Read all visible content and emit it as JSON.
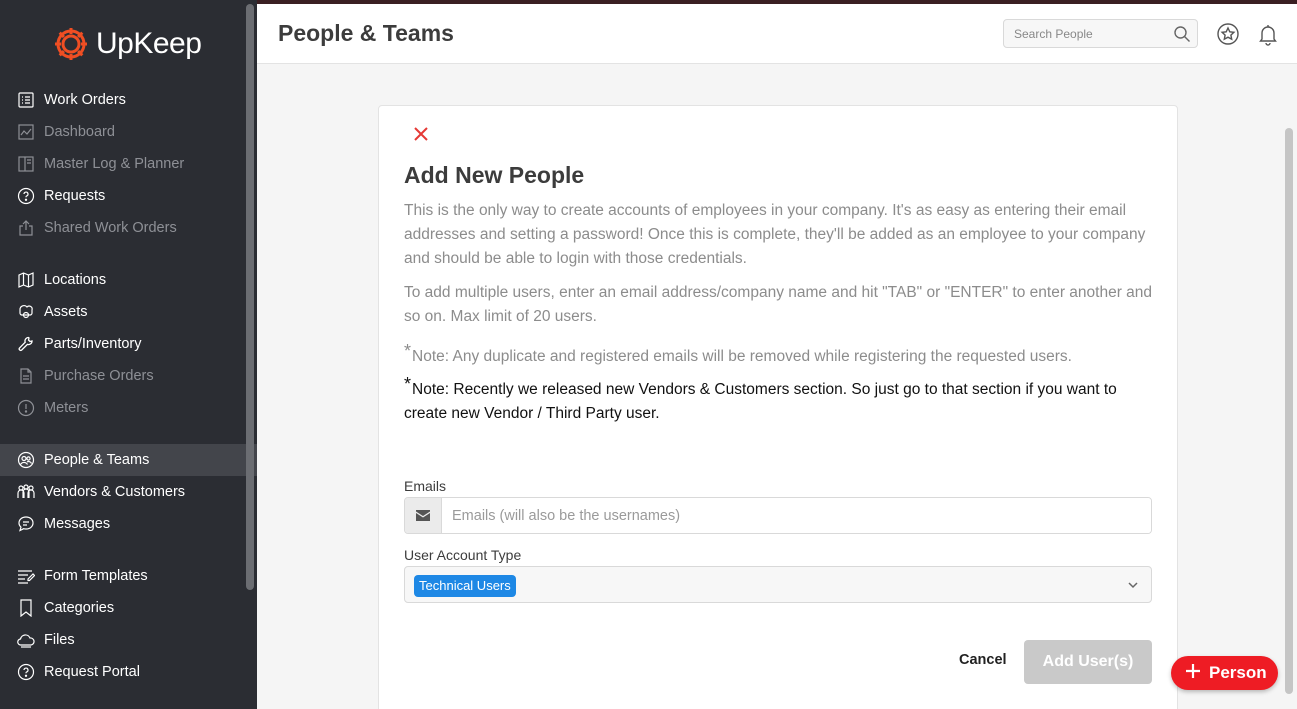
{
  "app": {
    "name": "UpKeep",
    "brand_color": "#f04e23"
  },
  "sidebar": {
    "groups": [
      [
        {
          "label": "Work Orders",
          "icon": "list-icon",
          "dim": false
        },
        {
          "label": "Dashboard",
          "icon": "chart-icon",
          "dim": true
        },
        {
          "label": "Master Log & Planner",
          "icon": "planner-icon",
          "dim": true
        },
        {
          "label": "Requests",
          "icon": "question-icon",
          "dim": false
        },
        {
          "label": "Shared Work Orders",
          "icon": "share-icon",
          "dim": true
        }
      ],
      [
        {
          "label": "Locations",
          "icon": "map-icon",
          "dim": false
        },
        {
          "label": "Assets",
          "icon": "cube-icon",
          "dim": false
        },
        {
          "label": "Parts/Inventory",
          "icon": "wrench-icon",
          "dim": false
        },
        {
          "label": "Purchase Orders",
          "icon": "document-icon",
          "dim": true
        },
        {
          "label": "Meters",
          "icon": "meter-icon",
          "dim": true
        }
      ],
      [
        {
          "label": "People & Teams",
          "icon": "people-icon",
          "dim": false,
          "active": true
        },
        {
          "label": "Vendors & Customers",
          "icon": "vendors-icon",
          "dim": false
        },
        {
          "label": "Messages",
          "icon": "chat-icon",
          "dim": false
        }
      ],
      [
        {
          "label": "Form Templates",
          "icon": "form-icon",
          "dim": false
        },
        {
          "label": "Categories",
          "icon": "bookmark-icon",
          "dim": false
        },
        {
          "label": "Files",
          "icon": "cloud-icon",
          "dim": false
        },
        {
          "label": "Request Portal",
          "icon": "question-icon",
          "dim": false
        }
      ]
    ]
  },
  "header": {
    "title": "People & Teams",
    "search_placeholder": "Search People"
  },
  "modal": {
    "title": "Add New People",
    "paragraph_1": "This is the only way to create accounts of employees in your company. It's as easy as entering their email addresses and setting a password! Once this is complete, they'll be added as an employee to your company and should be able to login with those credentials.",
    "paragraph_2": "To add multiple users, enter an email address/company name and hit \"TAB\" or \"ENTER\" to enter another and so on. Max limit of 20 users.",
    "note_1": "Note: Any duplicate and registered emails will be removed while registering the requested users.",
    "note_2": "Note: Recently we released new Vendors & Customers section. So just go to that section if you want to create new Vendor / Third Party user.",
    "note_marker": "*",
    "emails_label": "Emails",
    "emails_placeholder": "Emails (will also be the usernames)",
    "account_type_label": "User Account Type",
    "account_type_selected": "Technical Users",
    "cancel_label": "Cancel",
    "add_label": "Add User(s)"
  },
  "fab": {
    "label": "Person"
  }
}
